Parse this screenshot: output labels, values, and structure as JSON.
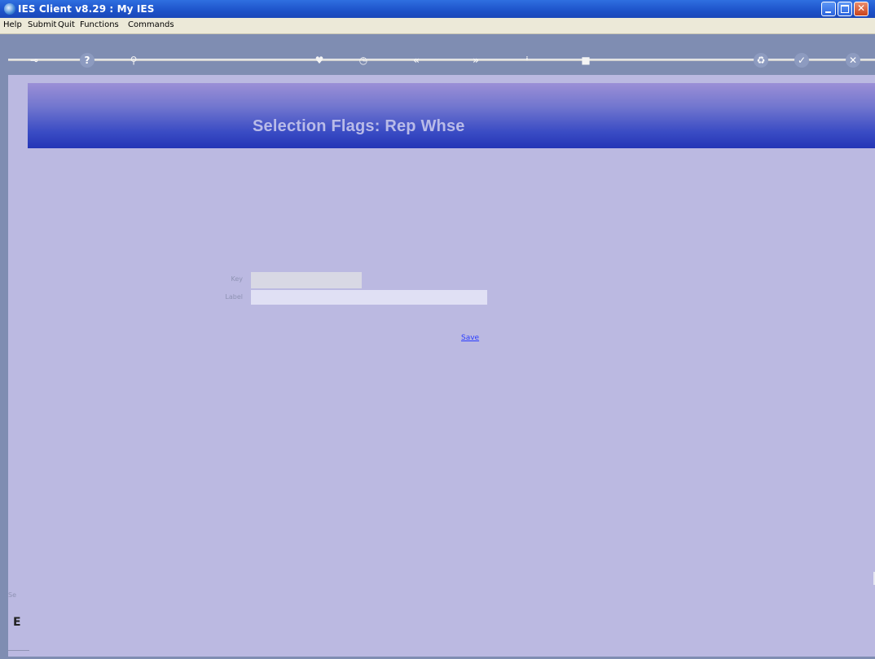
{
  "window": {
    "title": "IES Client v8.29 : My IES"
  },
  "menu": {
    "items": [
      "Help",
      "Submit",
      "Quit",
      "Functions",
      "Commands"
    ]
  },
  "toolbar": {
    "icons": [
      "key-icon",
      "help-icon",
      "search-icon",
      "heart-icon",
      "clock-icon",
      "previous-icon",
      "next-icon",
      "info-icon",
      "stop-icon",
      "recycle-icon",
      "check-icon",
      "close-icon"
    ]
  },
  "page": {
    "title": "Selection Flags: Rep Whse"
  },
  "form": {
    "key_label": "Key",
    "key_value": "",
    "label_label": "Label",
    "label_value": "",
    "save_label": "Save"
  },
  "status": {
    "label": "Se",
    "char": "E"
  },
  "colors": {
    "pane_background": "#bbb9e1",
    "header_gradient_top": "#9b8fd6",
    "header_gradient_bottom": "#2435b6",
    "link": "#2a3cff"
  }
}
